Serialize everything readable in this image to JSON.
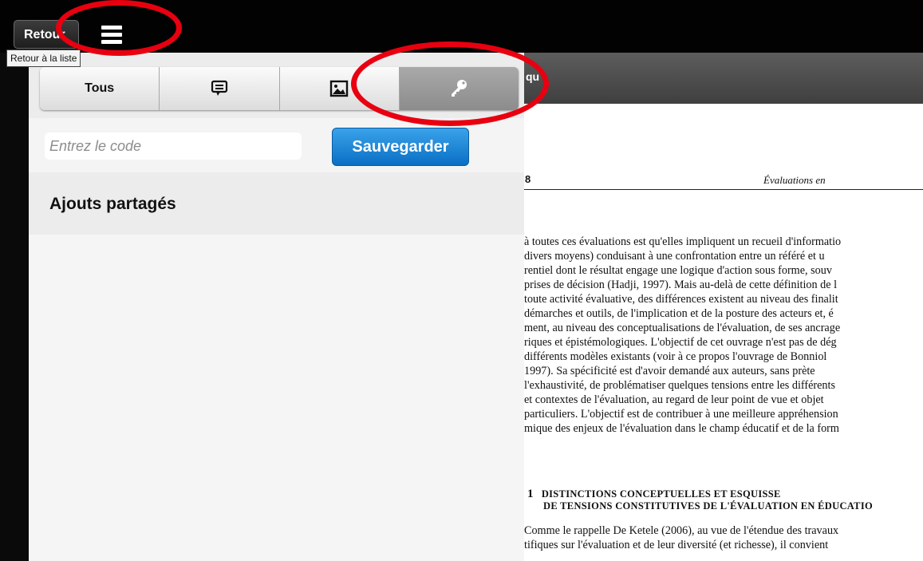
{
  "toolbar": {
    "back_label": "Retour",
    "tooltip": "Retour à la liste"
  },
  "tabs": [
    {
      "label": "Tous",
      "icon": "text"
    },
    {
      "label": "",
      "icon": "comment-icon"
    },
    {
      "label": "",
      "icon": "image-icon"
    },
    {
      "label": "",
      "icon": "key-icon"
    }
  ],
  "code_form": {
    "placeholder": "Entrez le code",
    "save_label": "Sauvegarder"
  },
  "shared": {
    "title": "Ajouts partagés"
  },
  "document": {
    "header_fragment": "qu",
    "page_number": "8",
    "running_head": "Évaluations en",
    "paragraph1": [
      "à toutes ces évaluations est qu'elles impliquent un recueil d'informatio",
      "divers moyens) conduisant à une confrontation entre un référé et u",
      "rentiel dont le résultat engage une logique d'action sous forme, souv",
      "prises de décision (Hadji, 1997). Mais au-delà de cette définition de l",
      "toute activité évaluative, des différences existent au niveau des finalit",
      "démarches et outils, de l'implication et de la posture des acteurs et, é",
      "ment, au niveau des conceptualisations de l'évaluation, de ses ancrage",
      "riques et épistémologiques. L'objectif de cet ouvrage n'est pas de dég",
      "différents modèles existants (voir à ce propos l'ouvrage de Bonniol",
      "1997). Sa spécificité est d'avoir demandé aux auteurs, sans prète",
      "l'exhaustivité, de problématiser quelques tensions entre les différents",
      "et contextes de l'évaluation, au regard de leur point de vue et objet",
      "particuliers. L'objectif est de contribuer à une meilleure appréhension",
      "mique des enjeux de l'évaluation dans le champ éducatif et de la form"
    ],
    "section_number": "1",
    "section_title_line1": "DISTINCTIONS CONCEPTUELLES ET ESQUISSE",
    "section_title_line2": "DE TENSIONS CONSTITUTIVES DE L'ÉVALUATION EN ÉDUCATIO",
    "paragraph2": [
      "Comme le rappelle De Ketele (2006), au vue de l'étendue des travaux",
      "tifiques sur l'évaluation et de leur diversité (et richesse), il convient"
    ]
  },
  "annotation_color": "#e80010"
}
